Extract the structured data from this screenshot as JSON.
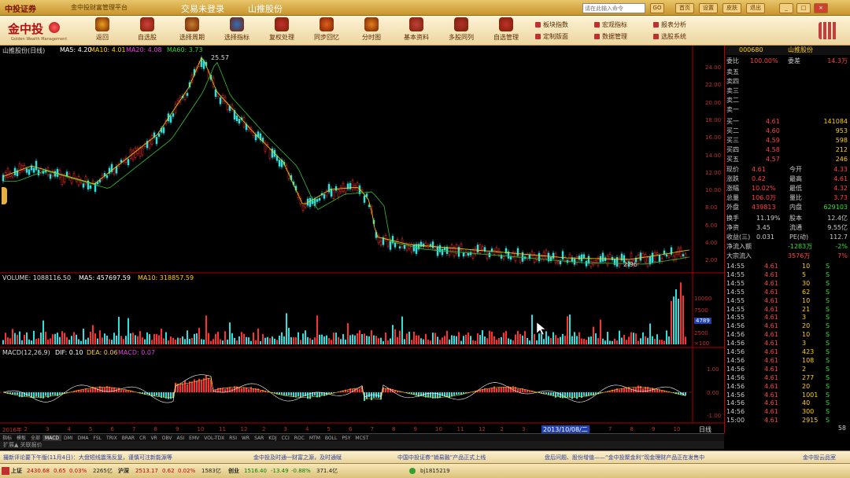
{
  "titlebar": {
    "logo": "中投证券",
    "subtitle": "金中投财富管理平台",
    "login": "交易未登录",
    "stock": "山推股份",
    "search_placeholder": "请在此输入命令",
    "go": "GO",
    "buttons": [
      "首页",
      "设置",
      "皮肤",
      "退出"
    ]
  },
  "toolbar": {
    "brand": "金中投",
    "brand_sub": "Golden Wealth Management",
    "tools": [
      {
        "label": "返回",
        "color": "#e8a020"
      },
      {
        "label": "自选股",
        "color": "#d04040"
      },
      {
        "label": "选择周期",
        "color": "#c08030"
      },
      {
        "label": "选择指标",
        "color": "#2a70c0"
      },
      {
        "label": "复权处理",
        "color": "#c03030"
      },
      {
        "label": "同步回忆",
        "color": "#e06020"
      },
      {
        "label": "分时图",
        "color": "#e08020"
      },
      {
        "label": "基本资料",
        "color": "#c04040"
      },
      {
        "label": "多股同列",
        "color": "#b03030"
      },
      {
        "label": "自选管理",
        "color": "#c03030"
      }
    ],
    "links": [
      "板块指数",
      "宏观指标",
      "报表分析",
      "定制版面",
      "数据管理",
      "选股系统"
    ]
  },
  "chart": {
    "kline_title": "山推股份(日线)",
    "ma5": "MA5: 4.20",
    "ma10": "MA10: 4.01",
    "ma20": "MA20: 4.08",
    "ma60": "MA60: 3.73",
    "high_label": "25.57",
    "low_label": "2.96",
    "vol_title": "VOLUME: 1088116.50",
    "vol_ma5": "MA5: 457697.59",
    "vol_ma10": "MA10: 318857.59",
    "macd_title": "MACD(12,26,9)",
    "macd_dif": "DIF: 0.10",
    "macd_dea": "DEA: 0.06",
    "macd_val": "MACD: 0.07",
    "price_ticks": [
      "24.00",
      "22.00",
      "20.00",
      "18.00",
      "16.00",
      "14.00",
      "12.00",
      "10.00",
      "8.00",
      "6.00",
      "4.00",
      "2.00"
    ],
    "vol_ticks": [
      "10000",
      "7500",
      "4789",
      "2500",
      "×100"
    ],
    "macd_ticks": [
      "1.00",
      "0.00",
      "-1.00"
    ],
    "xaxis": [
      "2016年",
      "2",
      "3",
      "4",
      "5",
      "6",
      "7",
      "8",
      "9",
      "10",
      "11",
      "12",
      "2",
      "3",
      "4",
      "5",
      "6",
      "7",
      "8",
      "9",
      "10",
      "11",
      "12",
      "2",
      "3",
      "4",
      "5",
      "6",
      "7",
      "8",
      "9",
      "10"
    ],
    "date_label": "2013/10/08/二",
    "period_label": "日线"
  },
  "tabs": [
    "指标",
    "模板",
    "全部",
    "MACD",
    "DMI",
    "DMA",
    "FSL",
    "TRIX",
    "BRAR",
    "CR",
    "VR",
    "OBV",
    "ASI",
    "EMV",
    "VOL-TDX",
    "RSI",
    "WR",
    "SAR",
    "KDJ",
    "CCI",
    "ROC",
    "MTM",
    "BOLL",
    "PSY",
    "MCST"
  ],
  "expand_label": "扩展▲ 关联报价",
  "rpanel": {
    "code": "000680",
    "name": "山推股份",
    "weibi_label": "委比",
    "weibi": "100.00%",
    "weicha_label": "委差",
    "weicha": "14.3万",
    "sell": [
      {
        "l": "卖五",
        "p": "",
        "v": ""
      },
      {
        "l": "卖四",
        "p": "",
        "v": ""
      },
      {
        "l": "卖三",
        "p": "",
        "v": ""
      },
      {
        "l": "卖二",
        "p": "",
        "v": ""
      },
      {
        "l": "卖一",
        "p": "",
        "v": ""
      }
    ],
    "buy": [
      {
        "l": "买一",
        "p": "4.61",
        "v": "141084"
      },
      {
        "l": "买二",
        "p": "4.60",
        "v": "953"
      },
      {
        "l": "买三",
        "p": "4.59",
        "v": "598"
      },
      {
        "l": "买四",
        "p": "4.58",
        "v": "212"
      },
      {
        "l": "买五",
        "p": "4.57",
        "v": "246"
      }
    ],
    "stats": [
      {
        "a": "现价",
        "b": "4.61",
        "c": "今开",
        "d": "4.33"
      },
      {
        "a": "涨跌",
        "b": "0.42",
        "c": "最高",
        "d": "4.61"
      },
      {
        "a": "涨幅",
        "b": "10.02%",
        "c": "最低",
        "d": "4.32"
      },
      {
        "a": "总量",
        "b": "106.0万",
        "c": "量比",
        "d": "3.73"
      },
      {
        "a": "外盘",
        "b": "439813",
        "c": "内盘",
        "d": "629103"
      }
    ],
    "stats2": [
      {
        "a": "换手",
        "b": "11.19%",
        "c": "股本",
        "d": "12.4亿"
      },
      {
        "a": "净资",
        "b": "3.45",
        "c": "流通",
        "d": "9.55亿"
      },
      {
        "a": "收益(三)",
        "b": "0.031",
        "c": "PE(动)",
        "d": "112.7"
      }
    ],
    "flow": [
      {
        "a": "净流入额",
        "b": "-1283万",
        "c": "-2%"
      },
      {
        "a": "大宗流入",
        "b": "3576万",
        "c": "7%"
      }
    ],
    "ticks": [
      {
        "t": "14:55",
        "p": "4.61",
        "v": "10",
        "s": "S"
      },
      {
        "t": "14:55",
        "p": "4.61",
        "v": "5",
        "s": "S"
      },
      {
        "t": "14:55",
        "p": "4.61",
        "v": "30",
        "s": "S"
      },
      {
        "t": "14:55",
        "p": "4.61",
        "v": "62",
        "s": "S"
      },
      {
        "t": "14:55",
        "p": "4.61",
        "v": "10",
        "s": "S"
      },
      {
        "t": "14:55",
        "p": "4.61",
        "v": "21",
        "s": "S"
      },
      {
        "t": "14:55",
        "p": "4.61",
        "v": "3",
        "s": "S"
      },
      {
        "t": "14:56",
        "p": "4.61",
        "v": "20",
        "s": "S"
      },
      {
        "t": "14:56",
        "p": "4.61",
        "v": "10",
        "s": "S"
      },
      {
        "t": "14:56",
        "p": "4.61",
        "v": "3",
        "s": "S"
      },
      {
        "t": "14:56",
        "p": "4.61",
        "v": "423",
        "s": "S"
      },
      {
        "t": "14:56",
        "p": "4.61",
        "v": "108",
        "s": "S"
      },
      {
        "t": "14:56",
        "p": "4.61",
        "v": "2",
        "s": "S"
      },
      {
        "t": "14:56",
        "p": "4.61",
        "v": "277",
        "s": "S"
      },
      {
        "t": "14:56",
        "p": "4.61",
        "v": "20",
        "s": "S"
      },
      {
        "t": "14:56",
        "p": "4.61",
        "v": "1001",
        "s": "S"
      },
      {
        "t": "14:56",
        "p": "4.61",
        "v": "40",
        "s": "S"
      },
      {
        "t": "14:56",
        "p": "4.61",
        "v": "300",
        "s": "S"
      },
      {
        "t": "15:00",
        "p": "4.61",
        "v": "2915",
        "s": "S"
      }
    ],
    "footer": "58"
  },
  "news": [
    "撮新评论要下午版(11月4日)：大盘短线震荡反复，谨慎可注新能源等",
    "金中投及时通一财富之源，及时通赋",
    "中国中投证券“销易融”产品正式上线",
    "盘后问题、股份增值——“金中投聚金利”现金理财产品正在发售中",
    "金中投云品室"
  ],
  "status": {
    "sh_label": "上证",
    "sh_val": "2430.68",
    "sh_chg": "0.65",
    "sh_pct": "0.03%",
    "sh_amt": "2265亿",
    "hs_label": "沪深",
    "hs_val": "2513.17",
    "hs_chg": "0.62",
    "hs_pct": "0.02%",
    "hs_amt": "1583亿",
    "cy_label": "创业",
    "cy_val": "1516.40",
    "cy_chg": "-13.49",
    "cy_pct": "-0.88%",
    "cy_amt": "371.4亿",
    "server": "bj1815219"
  }
}
